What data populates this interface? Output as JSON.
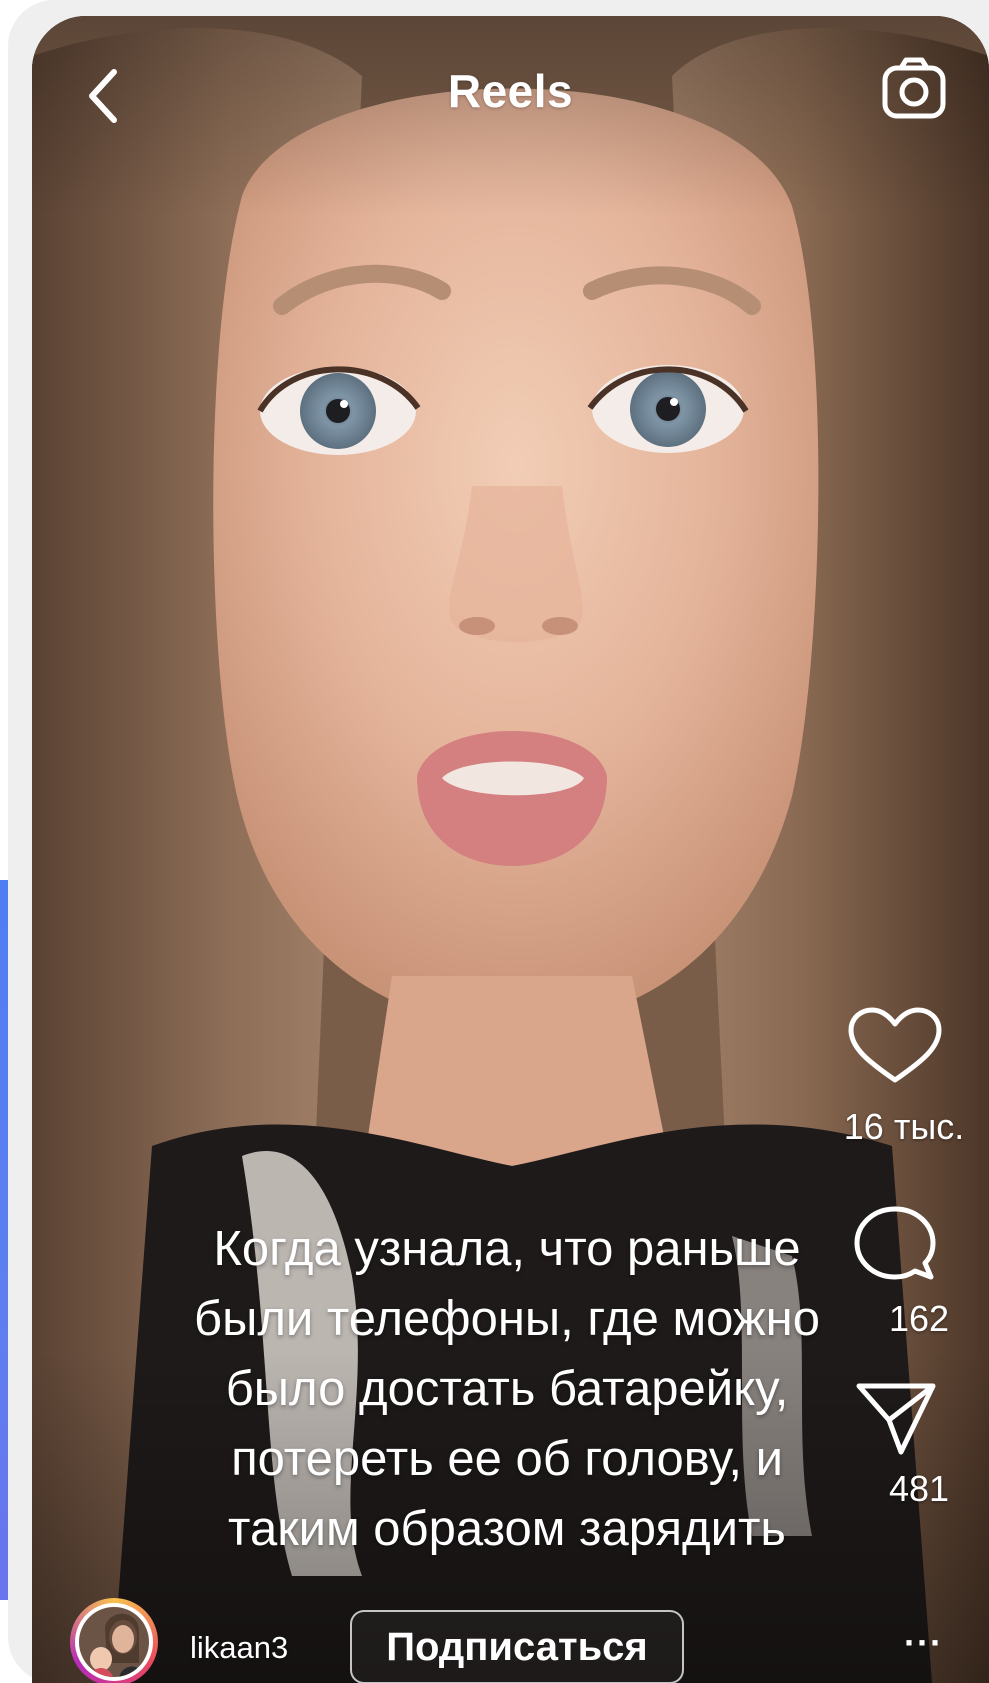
{
  "header": {
    "title": "Reels",
    "back_icon": "chevron-left-icon",
    "camera_icon": "camera-icon"
  },
  "actions": {
    "likes": {
      "icon": "heart-icon",
      "count": "16 тыс."
    },
    "comments": {
      "icon": "comment-bubble-icon",
      "count": "162"
    },
    "shares": {
      "icon": "send-icon",
      "count": "481"
    }
  },
  "caption": {
    "lines": [
      "Когда узнала, что раньше",
      "были телефоны, где можно",
      "было достать батарейку,",
      "потереть ее об голову, и",
      "таким образом зарядить"
    ]
  },
  "author": {
    "username": "likaan3",
    "follow_label": "Подписаться",
    "more_label": "···"
  },
  "colors": {
    "accent_blue": "#4f7ef2",
    "text": "#ffffff"
  }
}
